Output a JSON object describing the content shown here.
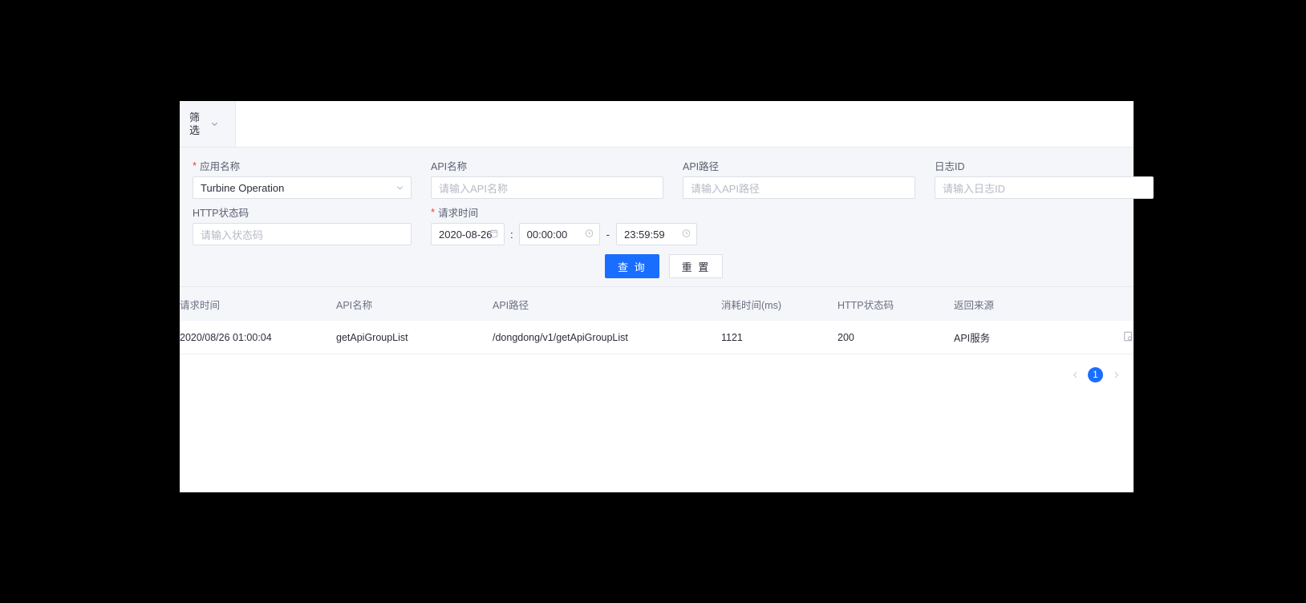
{
  "tab": {
    "label": "筛选",
    "caret_icon": "chevron-down-icon"
  },
  "filter": {
    "app_name": {
      "label": "应用名称",
      "required": true,
      "value": "Turbine Operation",
      "caret_icon": "chevron-down-icon"
    },
    "api_name": {
      "label": "API名称",
      "placeholder": "请输入API名称",
      "value": ""
    },
    "api_path": {
      "label": "API路径",
      "placeholder": "请输入API路径",
      "value": ""
    },
    "log_id": {
      "label": "日志ID",
      "placeholder": "请输入日志ID",
      "value": ""
    },
    "http_status": {
      "label": "HTTP状态码",
      "placeholder": "请输入状态码",
      "value": ""
    },
    "request_time": {
      "label": "请求时间",
      "required": true,
      "date": "2020-08-26",
      "colon": ":",
      "start_time": "00:00:00",
      "separator": "-",
      "end_time": "23:59:59",
      "calendar_icon": "calendar-icon",
      "clock_icon": "clock-icon"
    },
    "buttons": {
      "query": "查 询",
      "reset": "重 置"
    }
  },
  "table": {
    "columns": [
      "请求时间",
      "API名称",
      "API路径",
      "消耗时间(ms)",
      "HTTP状态码",
      "返回来源",
      ""
    ],
    "rows": [
      {
        "request_time": "2020/08/26 01:00:04",
        "api_name": "getApiGroupList",
        "api_path": "/dongdong/v1/getApiGroupList",
        "duration_ms": "1121",
        "http_status": "200",
        "source": "API服务",
        "action_icon": "file-search-icon"
      }
    ]
  },
  "pagination": {
    "prev_icon": "chevron-left-icon",
    "next_icon": "chevron-right-icon",
    "current_page": "1"
  },
  "colors": {
    "accent": "#1a6eff",
    "required": "#e8433f",
    "panel_bg": "#f5f6fa",
    "border": "#e8e8ed"
  }
}
